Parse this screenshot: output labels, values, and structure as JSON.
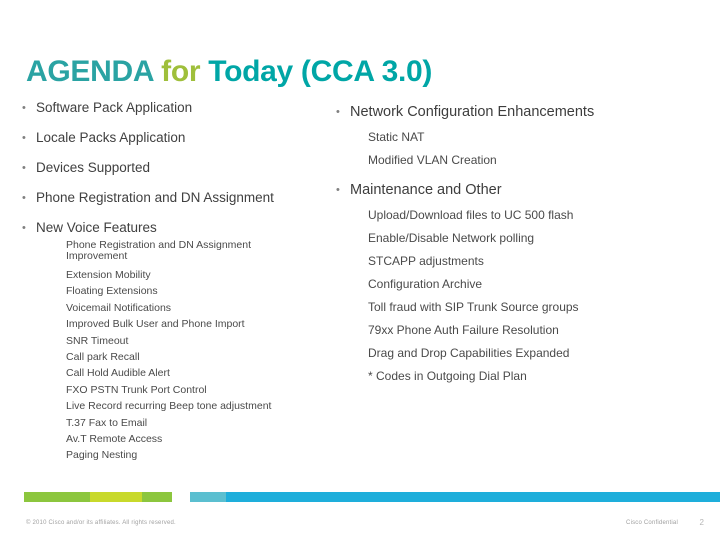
{
  "slide": {
    "title": {
      "part1": "AGENDA",
      "part2": " for ",
      "part3": "Today (CCA 3.0)"
    },
    "bullet_char": "•",
    "left_column": {
      "items": [
        {
          "label": "Software Pack Application"
        },
        {
          "label": "Locale Packs Application"
        },
        {
          "label": "Devices Supported"
        },
        {
          "label": "Phone Registration and DN Assignment"
        },
        {
          "label": "New Voice Features"
        }
      ],
      "sub_items": [
        "Phone Registration and DN Assignment",
        "Improvement",
        "Extension Mobility",
        "Floating Extensions",
        "Voicemail Notifications",
        "Improved Bulk User and Phone Import",
        "SNR Timeout",
        "Call park Recall",
        "Call Hold Audible Alert",
        "FXO PSTN Trunk Port Control",
        "Live Record recurring Beep tone adjustment",
        "T.37 Fax to Email",
        "Av.T Remote Access",
        "Paging Nesting"
      ]
    },
    "right_column": {
      "group1": {
        "heading": "Network Configuration Enhancements",
        "items": [
          "Static NAT",
          "Modified VLAN Creation"
        ]
      },
      "group2": {
        "heading": "Maintenance and Other",
        "items": [
          "Upload/Download files to UC 500 flash",
          "Enable/Disable Network polling",
          "STCAPP adjustments",
          "Configuration Archive",
          "Toll fraud with SIP Trunk Source groups",
          "79xx Phone Auth Failure Resolution",
          "Drag and Drop Capabilities Expanded",
          "* Codes in Outgoing Dial Plan"
        ]
      }
    },
    "footer": {
      "copyright": "© 2010 Cisco and/or its affiliates. All rights reserved.",
      "confidential": "Cisco Confidential",
      "page_number": "2"
    },
    "colors": {
      "title_teal": "#2aa3a3",
      "title_green": "#9fbf3b",
      "band_green": "#8cc63e",
      "band_lime": "#c8d92b",
      "band_cyan": "#5bbfd0",
      "band_blue": "#1eaedb"
    }
  }
}
